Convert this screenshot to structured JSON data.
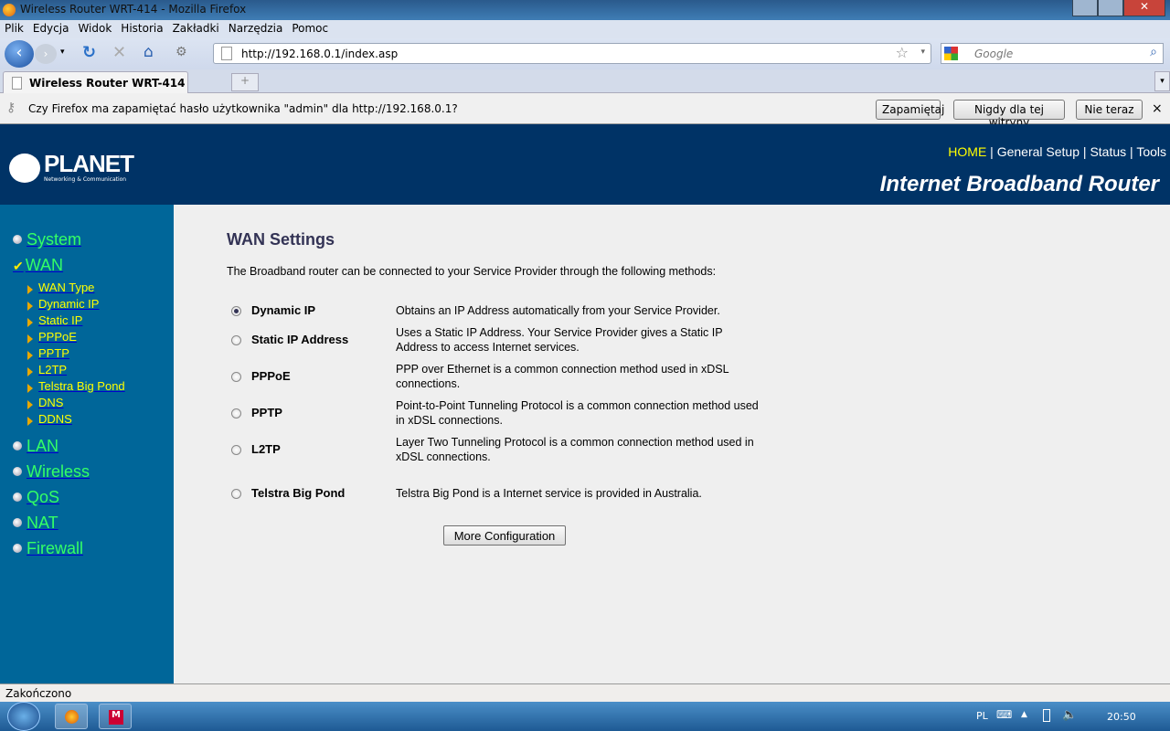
{
  "window": {
    "title": "Wireless Router WRT-414 - Mozilla Firefox"
  },
  "menu": [
    "Plik",
    "Edycja",
    "Widok",
    "Historia",
    "Zakładki",
    "Narzędzia",
    "Pomoc"
  ],
  "nav": {
    "url": "http://192.168.0.1/index.asp",
    "search_placeholder": "Google"
  },
  "tabs": [
    {
      "label": "Wireless Router WRT-414"
    }
  ],
  "new_tab": "+",
  "notification": {
    "text": "Czy Firefox ma zapamiętać hasło użytkownika \"admin\" dla http://192.168.0.1?",
    "buttons": [
      "Zapamiętaj",
      "Nigdy dla tej witryny",
      "Nie teraz"
    ],
    "close": "×"
  },
  "header": {
    "logo": "PLANET Networking & Communication",
    "nav": [
      "HOME",
      "General Setup",
      "Status",
      "Tools"
    ],
    "brand": "Internet Broadband Router"
  },
  "sidebar": {
    "top": [
      "System",
      "WAN"
    ],
    "wan_sub": [
      "WAN Type",
      "Dynamic IP",
      "Static IP",
      "PPPoE",
      "PPTP",
      "L2TP",
      "Telstra Big Pond",
      "DNS",
      "DDNS"
    ],
    "bottom": [
      "LAN",
      "Wireless",
      "QoS",
      "NAT",
      "Firewall"
    ]
  },
  "main": {
    "title": "WAN Settings",
    "intro": "The Broadband router can be connected to your Service Provider through the following methods:",
    "options": [
      {
        "label": "Dynamic IP",
        "desc": "Obtains an IP Address automatically from your Service Provider.",
        "selected": true
      },
      {
        "label": "Static IP Address",
        "desc": "Uses a Static IP Address. Your Service Provider gives a Static IP Address to access Internet services.",
        "selected": false
      },
      {
        "label": "PPPoE",
        "desc": "PPP over Ethernet is a common connection method used in xDSL connections.",
        "selected": false
      },
      {
        "label": "PPTP",
        "desc": "Point-to-Point Tunneling Protocol is a common connection method used in xDSL connections.",
        "selected": false
      },
      {
        "label": "L2TP",
        "desc": "Layer Two Tunneling Protocol is a common connection method used in xDSL connections.",
        "selected": false
      },
      {
        "label": "Telstra Big Pond",
        "desc": "Telstra Big Pond is a Internet service is provided in Australia.",
        "selected": false
      }
    ],
    "button": "More Configuration"
  },
  "status": "Zakończono",
  "taskbar": {
    "lang": "PL",
    "clock": "20:50"
  },
  "colors": {
    "header": "#003366",
    "sidebar": "#006699",
    "menu_main": "#33ff66",
    "menu_sub": "#ffff00"
  }
}
